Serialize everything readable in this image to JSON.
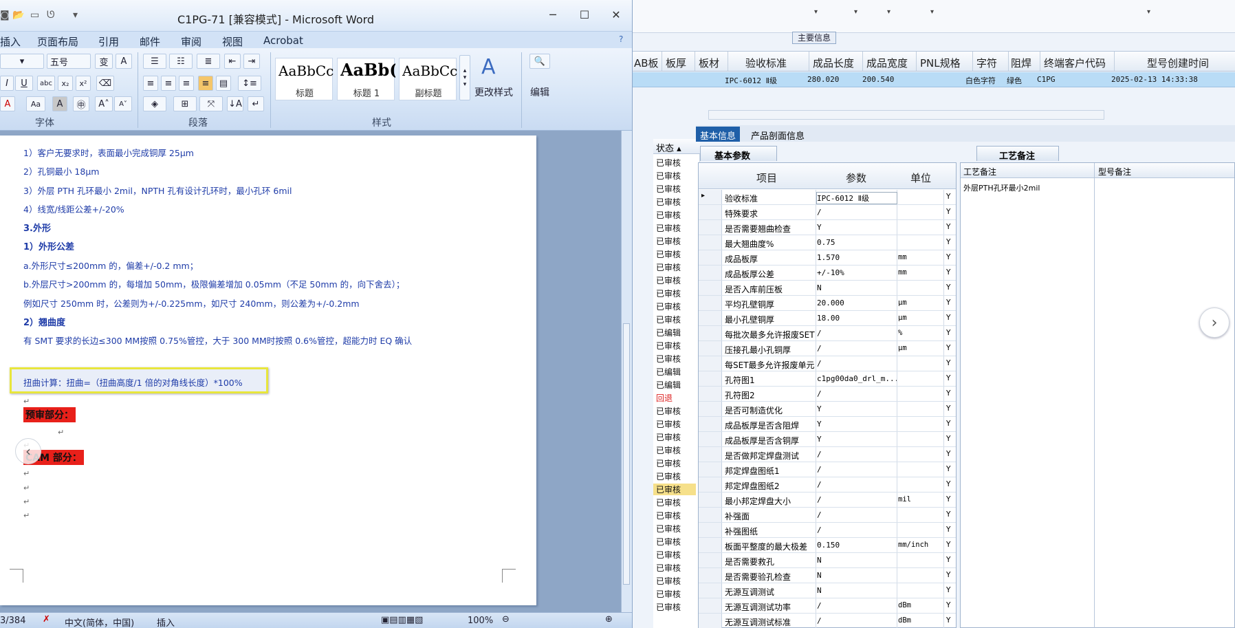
{
  "word": {
    "title": "C1PG-71 [兼容模式] - Microsoft Word",
    "tabs": [
      "插入",
      "页面布局",
      "引用",
      "邮件",
      "审阅",
      "视图",
      "Acrobat"
    ],
    "font_size": "五号",
    "groups": {
      "font": "字体",
      "paragraph": "段落",
      "styles": "样式"
    },
    "styles": [
      {
        "sample": "AaBbCc",
        "label": "标题"
      },
      {
        "sample": "AaBb(",
        "label": "标题 1"
      },
      {
        "sample": "AaBbCc",
        "label": "副标题"
      }
    ],
    "change_styles": "更改样式",
    "edit": "编辑",
    "doc_lines": [
      {
        "text": "1）客户无要求时，表面最小完成铜厚 25μm",
        "bold": false
      },
      {
        "text": "2）孔铜最小 18μm",
        "bold": false
      },
      {
        "text": "3）外层 PTH 孔环最小 2mil，NPTH 孔有设计孔环时，最小孔环 6mil",
        "bold": false
      },
      {
        "text": "4）线宽/线距公差+/-20%",
        "bold": false
      },
      {
        "text": "3.外形",
        "bold": true
      },
      {
        "text": "1）外形公差",
        "bold": true
      },
      {
        "text": "a.外形尺寸≤200mm 的，偏差+/-0.2 mm；",
        "bold": false
      },
      {
        "text": "b.外层尺寸>200mm 的，每增加 50mm，极限偏差增加 0.05mm（不足 50mm 的，向下舍去）；",
        "bold": false
      },
      {
        "text": "例如尺寸 250mm 时，公差则为+/-0.225mm，如尺寸 240mm，则公差为+/-0.2mm",
        "bold": false
      },
      {
        "text": "2）翘曲度",
        "bold": true
      },
      {
        "text": "有 SMT 要求的长边≤300 MM按照 0.75%管控，大于 300 MM时按照 0.6%管控，超能力时 EQ 确认",
        "bold": false
      }
    ],
    "highlight_line": "扭曲计算：扭曲=（扭曲高度/1 倍的对角线长度）*100%",
    "section_review": "预审部分：",
    "section_cam": "CAM 部分：",
    "status": {
      "page": "3/384",
      "lang": "中文(简体，中国)",
      "mode": "插入",
      "zoom": "100%"
    }
  },
  "app": {
    "group_title": "主要信息",
    "main_headers": [
      "AB板",
      "板厚",
      "板材",
      "验收标准",
      "成品长度",
      "成品宽度",
      "PNL规格",
      "字符",
      "阻焊",
      "终端客户代码",
      "型号创建时间"
    ],
    "main_row": {
      "acceptance": "IPC-6012 Ⅱ级",
      "length": "280.020",
      "width": "200.540",
      "char": "白色字符",
      "mask": "绿色",
      "customer": "C1PG",
      "created": "2025-02-13 14:33:38"
    },
    "status_header": "状态",
    "status_values": [
      "已审核",
      "已审核",
      "已审核",
      "已审核",
      "已审核",
      "已审核",
      "已审核",
      "已审核",
      "已审核",
      "已审核",
      "已审核",
      "已审核",
      "已审核",
      "已编辑",
      "已审核",
      "已审核",
      "已编辑",
      "已编辑",
      "回退",
      "已审核",
      "已审核",
      "已审核",
      "已审核",
      "已审核",
      "已审核",
      "已审核",
      "已审核",
      "已审核",
      "已审核",
      "已审核",
      "已审核",
      "已审核",
      "已审核",
      "已审核",
      "已审核"
    ],
    "tabs": [
      "基本信息",
      "产品剖面信息"
    ],
    "sub_basic": "基本参数",
    "sub_process": "工艺备注",
    "param_headers": {
      "item": "项目",
      "param": "参数",
      "unit": "单位"
    },
    "params": [
      {
        "item": "验收标准",
        "param": "IPC-6012 Ⅱ级",
        "unit": "",
        "flag": "Y"
      },
      {
        "item": "特殊要求",
        "param": "/",
        "unit": "",
        "flag": "Y"
      },
      {
        "item": "是否需要翘曲检查",
        "param": "Y",
        "unit": "",
        "flag": "Y"
      },
      {
        "item": "最大翘曲度%",
        "param": "0.75",
        "unit": "",
        "flag": "Y"
      },
      {
        "item": "成品板厚",
        "param": "1.570",
        "unit": "mm",
        "flag": "Y"
      },
      {
        "item": "成品板厚公差",
        "param": "+/-10%",
        "unit": "mm",
        "flag": "Y"
      },
      {
        "item": "是否入库前压板",
        "param": "N",
        "unit": "",
        "flag": "Y"
      },
      {
        "item": "平均孔壁铜厚",
        "param": "20.000",
        "unit": "μm",
        "flag": "Y"
      },
      {
        "item": "最小孔壁铜厚",
        "param": "18.00",
        "unit": "μm",
        "flag": "Y"
      },
      {
        "item": "每批次最多允许报废SET",
        "param": "/",
        "unit": "%",
        "flag": "Y"
      },
      {
        "item": "压接孔最小孔铜厚",
        "param": "/",
        "unit": "μm",
        "flag": "Y"
      },
      {
        "item": "每SET最多允许报废单元",
        "param": "/",
        "unit": "",
        "flag": "Y"
      },
      {
        "item": "孔符图1",
        "param": "c1pg00da0_drl_m...",
        "unit": "",
        "flag": "Y"
      },
      {
        "item": "孔符图2",
        "param": "/",
        "unit": "",
        "flag": "Y"
      },
      {
        "item": "是否可制造优化",
        "param": "Y",
        "unit": "",
        "flag": "Y"
      },
      {
        "item": "成品板厚是否含阻焊",
        "param": "Y",
        "unit": "",
        "flag": "Y"
      },
      {
        "item": "成品板厚是否含铜厚",
        "param": "Y",
        "unit": "",
        "flag": "Y"
      },
      {
        "item": "是否做邦定焊盘测试",
        "param": "/",
        "unit": "",
        "flag": "Y"
      },
      {
        "item": "邦定焊盘图纸1",
        "param": "/",
        "unit": "",
        "flag": "Y"
      },
      {
        "item": "邦定焊盘图纸2",
        "param": "/",
        "unit": "",
        "flag": "Y"
      },
      {
        "item": "最小邦定焊盘大小",
        "param": "/",
        "unit": "mil",
        "flag": "Y"
      },
      {
        "item": "补强面",
        "param": "/",
        "unit": "",
        "flag": "Y"
      },
      {
        "item": "补强图纸",
        "param": "/",
        "unit": "",
        "flag": "Y"
      },
      {
        "item": "板面平整度的最大极差",
        "param": "0.150",
        "unit": "mm/inch",
        "flag": "Y"
      },
      {
        "item": "是否需要救孔",
        "param": "N",
        "unit": "",
        "flag": "Y"
      },
      {
        "item": "是否需要验孔检查",
        "param": "N",
        "unit": "",
        "flag": "Y"
      },
      {
        "item": "无源互调测试",
        "param": "N",
        "unit": "",
        "flag": "Y"
      },
      {
        "item": "无源互调测试功率",
        "param": "/",
        "unit": "dBm",
        "flag": "Y"
      },
      {
        "item": "无源互调测试标准",
        "param": "/",
        "unit": "dBm",
        "flag": "Y"
      }
    ],
    "process_headers": [
      "工艺备注",
      "型号备注"
    ],
    "process_note": "外层PTH孔环最小2mil"
  },
  "icons": {
    "nav_prev": "‹",
    "nav_next": "›"
  },
  "colors": {
    "accent": "#1f5fa8",
    "highlight_border": "#e8e63c",
    "red_label": "#e8201a",
    "doc_text": "#1f3ca8"
  }
}
